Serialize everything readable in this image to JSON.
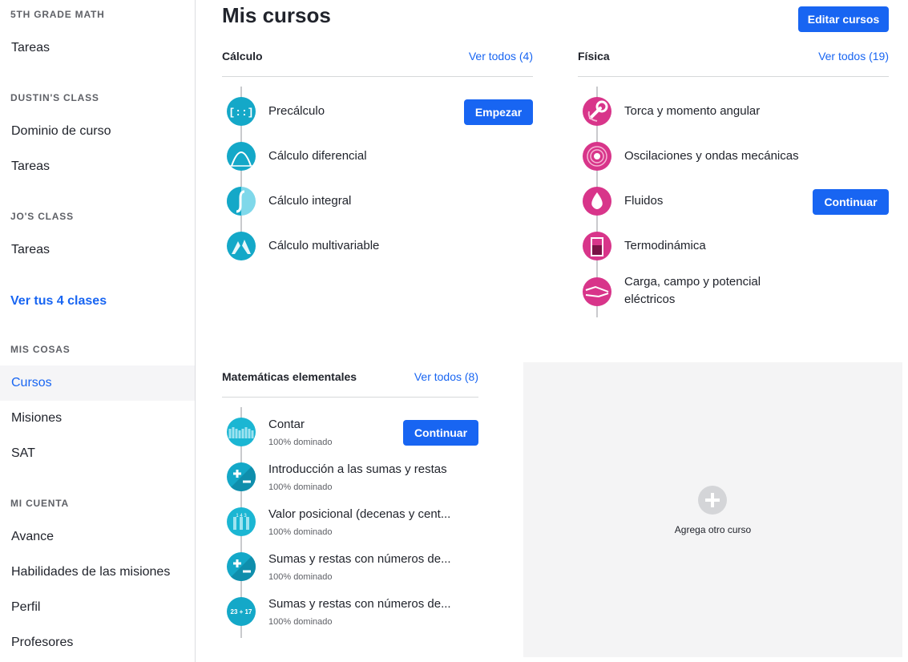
{
  "sidebar": {
    "sections": [
      {
        "heading": "5TH GRADE MATH",
        "items": [
          "Tareas"
        ]
      },
      {
        "heading": "DUSTIN'S CLASS",
        "items": [
          "Dominio de curso",
          "Tareas"
        ]
      },
      {
        "heading": "JO'S CLASS",
        "items": [
          "Tareas"
        ]
      },
      {
        "heading": "MIS COSAS",
        "items": [
          "Cursos",
          "Misiones",
          "SAT"
        ]
      },
      {
        "heading": "MI CUENTA",
        "items": [
          "Avance",
          "Habilidades de las misiones",
          "Perfil",
          "Profesores"
        ]
      }
    ],
    "see_classes": "Ver tus 4 clases",
    "active_item": "Cursos"
  },
  "main": {
    "title": "Mis cursos",
    "edit_button": "Editar cursos",
    "calculo": {
      "title": "Cálculo",
      "see_all": "Ver todos (4)",
      "courses": [
        {
          "name": "Precálculo",
          "button": "Empezar",
          "icon": "precalc-icon"
        },
        {
          "name": "Cálculo diferencial",
          "icon": "diff-calc-icon"
        },
        {
          "name": "Cálculo integral",
          "icon": "integral-calc-icon"
        },
        {
          "name": "Cálculo multivariable",
          "icon": "multivariable-calc-icon"
        }
      ]
    },
    "fisica": {
      "title": "Física",
      "see_all": "Ver todos (19)",
      "courses": [
        {
          "name": "Torca y momento angular",
          "icon": "wrench-icon"
        },
        {
          "name": "Oscilaciones y ondas mecánicas",
          "icon": "waves-icon"
        },
        {
          "name": "Fluidos",
          "button": "Continuar",
          "icon": "drop-icon"
        },
        {
          "name": "Termodinámica",
          "icon": "beaker-icon"
        },
        {
          "name": "Carga, campo y potencial eléctricos",
          "icon": "handshake-icon"
        }
      ]
    },
    "elementales": {
      "title": "Matemáticas elementales",
      "see_all": "Ver todos (8)",
      "courses": [
        {
          "name": "Contar",
          "progress": "100% dominado",
          "button": "Continuar",
          "icon": "hands-icon"
        },
        {
          "name": "Introducción a las sumas y restas",
          "progress": "100% dominado",
          "icon": "plus-minus-icon"
        },
        {
          "name": "Valor posicional (decenas y cent...",
          "progress": "100% dominado",
          "icon": "place-value-icon"
        },
        {
          "name": "Sumas y restas con números de...",
          "progress": "100% dominado",
          "icon": "plus-minus-icon"
        },
        {
          "name": "Sumas y restas con números de...",
          "progress": "100% dominado",
          "icon": "sum-23-17-icon",
          "icon_text": "23 + 17"
        }
      ]
    },
    "add_course": "Agrega otro curso"
  }
}
